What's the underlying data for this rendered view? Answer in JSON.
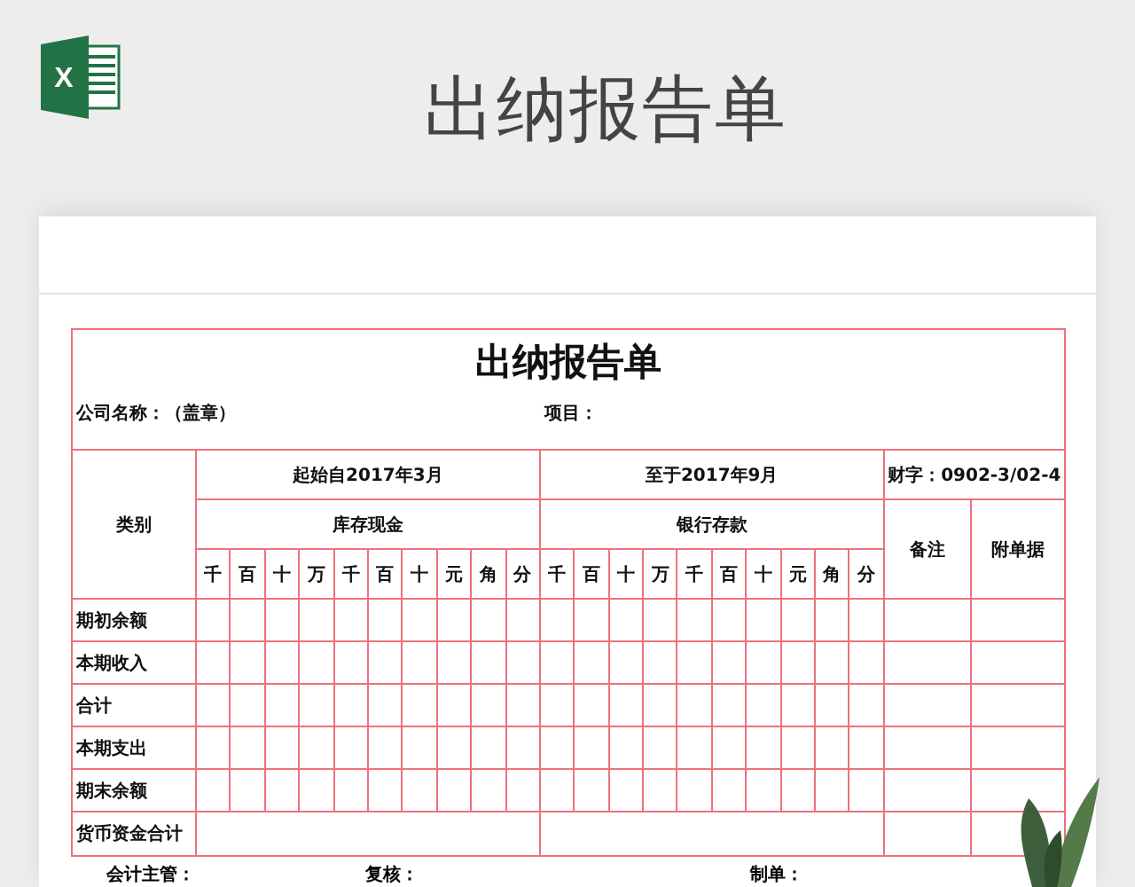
{
  "header": {
    "icon_letter": "X",
    "title": "出纳报告单"
  },
  "sheet": {
    "title": "出纳报告单",
    "company_label": "公司名称：（盖章）",
    "project_label": "项目：",
    "period_start": "起始自2017年3月",
    "period_end": "至于2017年9月",
    "voucher_no": "财字：0902-3/02-4",
    "category_header": "类别",
    "cash_header": "库存现金",
    "bank_header": "银行存款",
    "notes_header": "备注",
    "attachments_header": "附单据",
    "cash_digits": [
      "千",
      "百",
      "十",
      "万",
      "千",
      "百",
      "十",
      "元",
      "角",
      "分"
    ],
    "bank_digits": [
      "千",
      "百",
      "十",
      "万",
      "千",
      "百",
      "十",
      "元",
      "角",
      "分"
    ],
    "rows": [
      {
        "label": "期初余额",
        "kind": "digits"
      },
      {
        "label": "本期收入",
        "kind": "digits"
      },
      {
        "label": "合计",
        "kind": "digits"
      },
      {
        "label": "本期支出",
        "kind": "digits"
      },
      {
        "label": "期末余额",
        "kind": "digits"
      },
      {
        "label": "货币资金合计",
        "kind": "merged"
      }
    ],
    "signatures": [
      "会计主管：",
      "复核：",
      "制单："
    ]
  }
}
